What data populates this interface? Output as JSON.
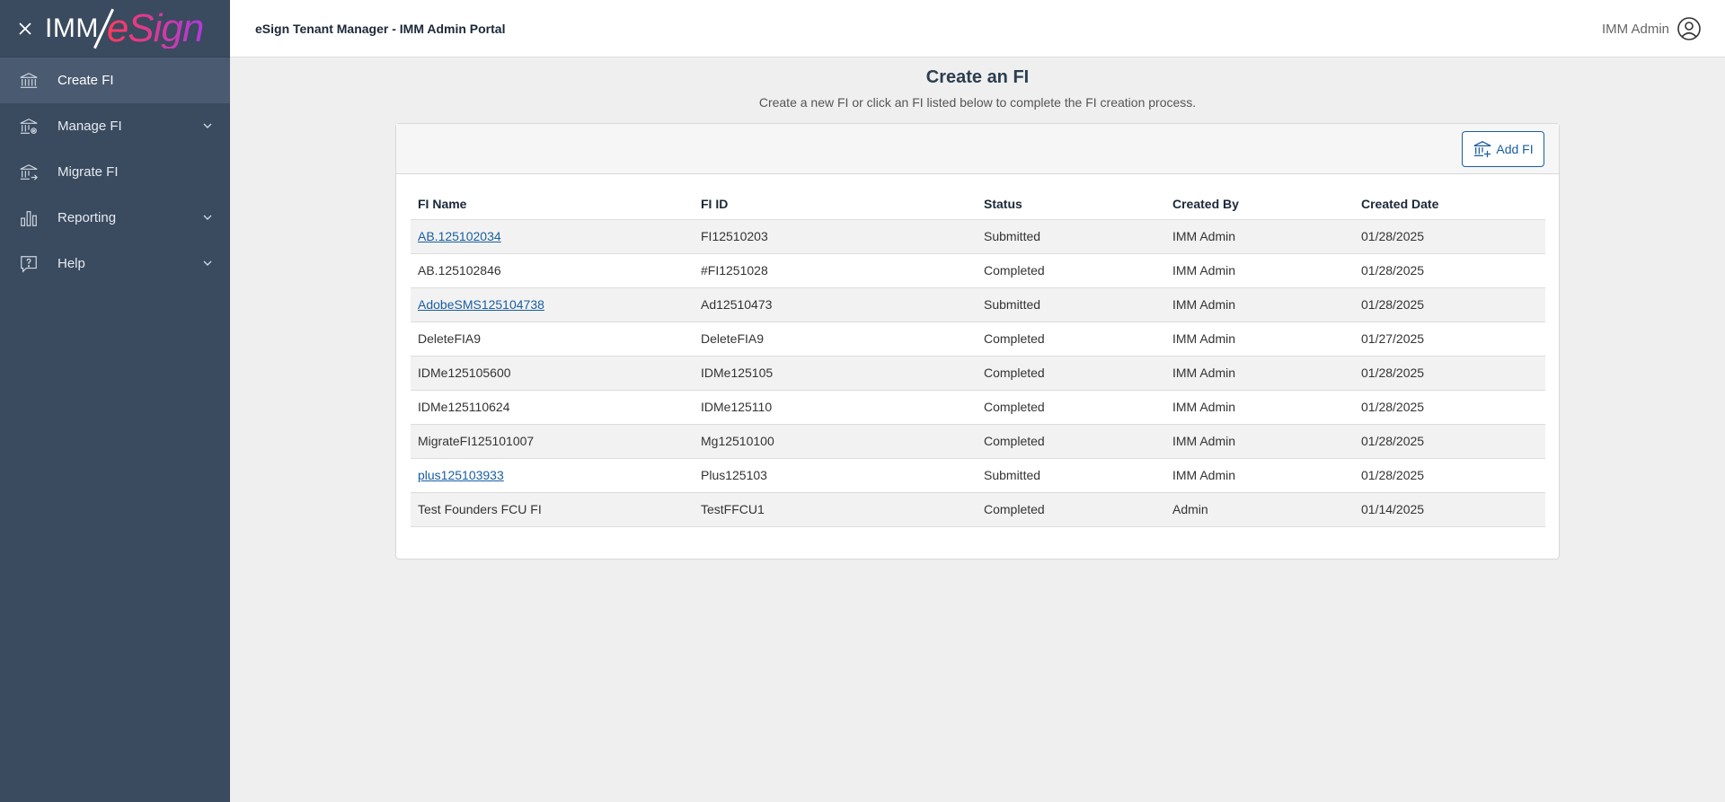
{
  "brand": {
    "logo_imm": "IMM",
    "logo_esign": "eSign"
  },
  "sidebar": {
    "items": [
      {
        "label": "Create FI",
        "icon": "bank-icon",
        "active": true,
        "expandable": false
      },
      {
        "label": "Manage FI",
        "icon": "bank-gear-icon",
        "active": false,
        "expandable": true
      },
      {
        "label": "Migrate FI",
        "icon": "bank-arrow-icon",
        "active": false,
        "expandable": false
      },
      {
        "label": "Reporting",
        "icon": "bar-chart-icon",
        "active": false,
        "expandable": true
      },
      {
        "label": "Help",
        "icon": "help-icon",
        "active": false,
        "expandable": true
      }
    ]
  },
  "header": {
    "title": "eSign Tenant Manager - IMM Admin Portal",
    "user_name": "IMM Admin"
  },
  "page": {
    "title": "Create an FI",
    "subtitle": "Create a new FI or click an FI listed below to complete the FI creation process.",
    "add_button_label": "Add FI"
  },
  "table": {
    "columns": [
      "FI Name",
      "FI ID",
      "Status",
      "Created By",
      "Created Date"
    ],
    "rows": [
      {
        "name": "AB.125102034",
        "id": "FI12510203",
        "status": "Submitted",
        "created_by": "IMM Admin",
        "date": "01/28/2025",
        "link": true
      },
      {
        "name": "AB.125102846",
        "id": "#FI1251028",
        "status": "Completed",
        "created_by": "IMM Admin",
        "date": "01/28/2025",
        "link": false
      },
      {
        "name": "AdobeSMS125104738",
        "id": "Ad12510473",
        "status": "Submitted",
        "created_by": "IMM Admin",
        "date": "01/28/2025",
        "link": true
      },
      {
        "name": "DeleteFIA9",
        "id": "DeleteFIA9",
        "status": "Completed",
        "created_by": "IMM Admin",
        "date": "01/27/2025",
        "link": false
      },
      {
        "name": "IDMe125105600",
        "id": "IDMe125105",
        "status": "Completed",
        "created_by": "IMM Admin",
        "date": "01/28/2025",
        "link": false
      },
      {
        "name": "IDMe125110624",
        "id": "IDMe125110",
        "status": "Completed",
        "created_by": "IMM Admin",
        "date": "01/28/2025",
        "link": false
      },
      {
        "name": "MigrateFI125101007",
        "id": "Mg12510100",
        "status": "Completed",
        "created_by": "IMM Admin",
        "date": "01/28/2025",
        "link": false
      },
      {
        "name": "plus125103933",
        "id": "Plus125103",
        "status": "Submitted",
        "created_by": "IMM Admin",
        "date": "01/28/2025",
        "link": true
      },
      {
        "name": "Test Founders FCU FI",
        "id": "TestFFCU1",
        "status": "Completed",
        "created_by": "Admin",
        "date": "01/14/2025",
        "link": false
      }
    ]
  },
  "colors": {
    "sidebar_bg": "#3a4a5f",
    "sidebar_active": "#4a5a70",
    "link": "#1a5ea1",
    "page_bg": "#efefef"
  }
}
